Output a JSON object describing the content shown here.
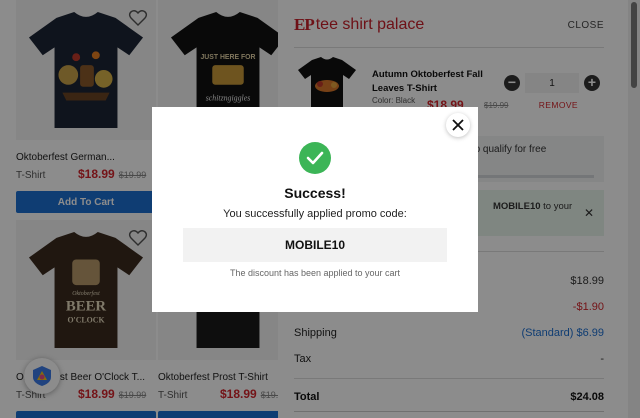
{
  "products": [
    {
      "name": "Oktoberfest German...",
      "type": "T-Shirt",
      "price": "$18.99",
      "old_price": "$19.99",
      "button": "Add To Cart",
      "shirt_color": "#1d2535",
      "print": "oktoberfest-german"
    },
    {
      "name": "",
      "type": "",
      "price": "",
      "old_price": "",
      "button": "",
      "shirt_color": "#111111",
      "print_line1": "JUST HERE FOR",
      "print_line2": "schitzngiggles"
    },
    {
      "name": "Oktoberfest Beer O'Clock T...",
      "type": "T-Shirt",
      "price": "$18.99",
      "old_price": "$19.99",
      "button": "",
      "shirt_color": "#3b2a1e",
      "print_line1": "Oktoberfest",
      "print_line2": "BEER",
      "print_line3": "O'CLOCK"
    },
    {
      "name": "Oktoberfest Prost T-Shirt",
      "type": "T-Shirt",
      "price": "$18.99",
      "old_price": "$19.99",
      "button": "",
      "shirt_color": "#1a1a1a"
    }
  ],
  "cart": {
    "logo_mark": "EP",
    "logo_text": "tee shirt palace",
    "close_label": "CLOSE",
    "item": {
      "name": "Autumn Oktoberfest Fall Leaves T-Shirt",
      "color_label": "Color: Black",
      "price": "$18.99",
      "old_price": "$19.99",
      "quantity": "1",
      "remove_label": "REMOVE"
    },
    "free_shipping_note": "ur order to qualify for free",
    "promo_applied_prefix": "",
    "promo_applied_code": "MOBILE10",
    "promo_applied_suffix": " to your",
    "summary": {
      "subtotal_value": "$18.99",
      "discount_value": "-$1.90",
      "shipping_label": "Shipping",
      "shipping_value": "(Standard) $6.99",
      "tax_label": "Tax",
      "tax_value": "-",
      "total_label": "Total",
      "total_value": "$24.08"
    }
  },
  "modal": {
    "title": "Success!",
    "message": "You successfully applied promo code:",
    "code": "MOBILE10",
    "note": "The discount has been applied to your cart"
  },
  "colors": {
    "accent_red": "#d3262c",
    "accent_blue": "#1d6fd1",
    "success_green": "#3cb557"
  }
}
